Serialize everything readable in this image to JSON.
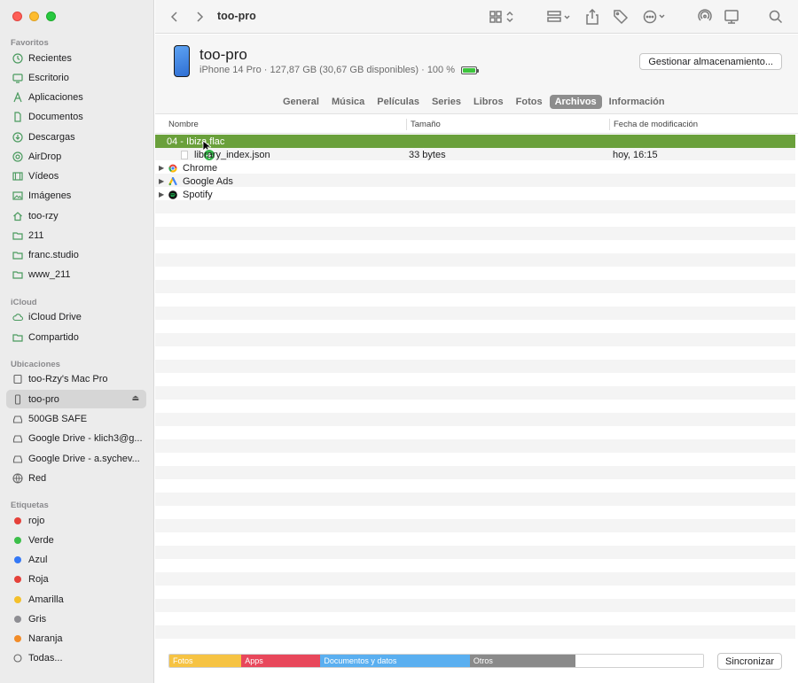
{
  "window": {
    "title": "too-pro"
  },
  "sidebar": {
    "sections": [
      {
        "title": "Favoritos",
        "items": [
          {
            "label": "Recientes",
            "icon": "clock-icon"
          },
          {
            "label": "Escritorio",
            "icon": "desktop-icon"
          },
          {
            "label": "Aplicaciones",
            "icon": "applications-icon"
          },
          {
            "label": "Documentos",
            "icon": "document-icon"
          },
          {
            "label": "Descargas",
            "icon": "download-icon"
          },
          {
            "label": "AirDrop",
            "icon": "airdrop-icon"
          },
          {
            "label": "Vídeos",
            "icon": "film-icon"
          },
          {
            "label": "Imágenes",
            "icon": "photo-icon"
          },
          {
            "label": "too-rzy",
            "icon": "home-icon"
          },
          {
            "label": "211",
            "icon": "folder-icon"
          },
          {
            "label": "franc.studio",
            "icon": "folder-icon"
          },
          {
            "label": "www_211",
            "icon": "folder-icon"
          }
        ]
      },
      {
        "title": "iCloud",
        "items": [
          {
            "label": "iCloud Drive",
            "icon": "cloud-icon"
          },
          {
            "label": "Compartido",
            "icon": "shared-folder-icon"
          }
        ]
      },
      {
        "title": "Ubicaciones",
        "items": [
          {
            "label": "too-Rzy's Mac Pro",
            "icon": "computer-icon"
          },
          {
            "label": "too-pro",
            "icon": "iphone-icon"
          },
          {
            "label": "500GB SAFE",
            "icon": "drive-icon"
          },
          {
            "label": "Google Drive - klich3@g...",
            "icon": "drive-icon"
          },
          {
            "label": "Google Drive - a.sychev...",
            "icon": "drive-icon"
          },
          {
            "label": "Red",
            "icon": "network-icon"
          }
        ]
      },
      {
        "title": "Etiquetas",
        "items": [
          {
            "label": "rojo",
            "color": "#e5413a"
          },
          {
            "label": "Verde",
            "color": "#3cbf4a"
          },
          {
            "label": "Azul",
            "color": "#3478f6"
          },
          {
            "label": "Roja",
            "color": "#e5413a"
          },
          {
            "label": "Amarilla",
            "color": "#f4c02b"
          },
          {
            "label": "Gris",
            "color": "#8e8e93"
          },
          {
            "label": "Naranja",
            "color": "#f28c28"
          },
          {
            "label": "Todas...",
            "icon": "tags-icon"
          }
        ]
      }
    ]
  },
  "device": {
    "name": "too-pro",
    "info": "iPhone 14 Pro · 127,87 GB (30,67 GB disponibles) · 100 %",
    "manage_label": "Gestionar almacenamiento..."
  },
  "tabs": [
    "General",
    "Música",
    "Películas",
    "Series",
    "Libros",
    "Fotos",
    "Archivos",
    "Información"
  ],
  "active_tab": "Archivos",
  "columns": {
    "name": "Nombre",
    "size": "Tamaño",
    "date": "Fecha de modificación"
  },
  "drag_item": "04 - Ibiza.flac",
  "rows": [
    {
      "name": "library_index.json",
      "size": "33 bytes",
      "date": "hoy, 16:15"
    },
    {
      "name": "Chrome",
      "size": "",
      "date": ""
    },
    {
      "name": "Google Ads",
      "size": "",
      "date": ""
    },
    {
      "name": "Spotify",
      "size": "",
      "date": ""
    }
  ],
  "storage": {
    "segments": [
      {
        "label": "Fotos",
        "color": "#f6c343",
        "fraction": 0.135
      },
      {
        "label": "Apps",
        "color": "#e8475b",
        "fraction": 0.148
      },
      {
        "label": "Documentos y datos",
        "color": "#5aaff0",
        "fraction": 0.28
      },
      {
        "label": "Otros",
        "color": "#8a8a8a",
        "fraction": 0.198
      },
      {
        "label": "",
        "color": "#ffffff",
        "fraction": 0.239
      }
    ],
    "sync_label": "Sincronizar"
  }
}
